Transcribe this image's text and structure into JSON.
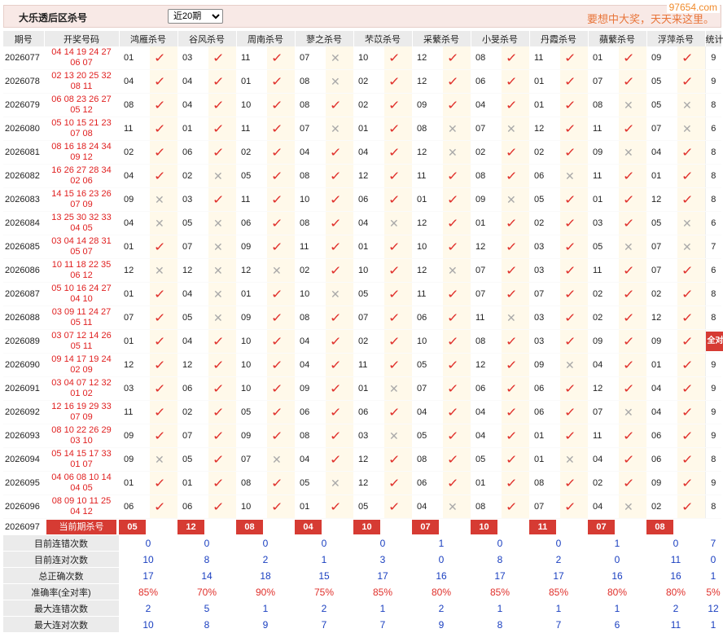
{
  "header": {
    "title": "大乐透后区杀号",
    "period_select": "近20期",
    "period_options": [
      "近20期"
    ],
    "slogan": "要想中大奖，天天来这里。",
    "watermark": "97654.com"
  },
  "columns": {
    "period": "期号",
    "winning": "开奖号码",
    "experts": [
      "鸿雁杀号",
      "谷风杀号",
      "周南杀号",
      "蓼之杀号",
      "芣苡杀号",
      "采蘩杀号",
      "小旻杀号",
      "丹霞杀号",
      "蘋蘩杀号",
      "浮萍杀号"
    ],
    "stat": "统计"
  },
  "rows": [
    {
      "period": "2026077",
      "line1": "04 14 19 24 27",
      "line2": "06 07",
      "picks": [
        [
          "01",
          1
        ],
        [
          "03",
          1
        ],
        [
          "11",
          1
        ],
        [
          "07",
          0
        ],
        [
          "10",
          1
        ],
        [
          "12",
          1
        ],
        [
          "08",
          1
        ],
        [
          "11",
          1
        ],
        [
          "01",
          1
        ],
        [
          "09",
          1
        ]
      ],
      "stat": "9"
    },
    {
      "period": "2026078",
      "line1": "02 13 20 25 32",
      "line2": "08 11",
      "picks": [
        [
          "04",
          1
        ],
        [
          "04",
          1
        ],
        [
          "01",
          1
        ],
        [
          "08",
          0
        ],
        [
          "02",
          1
        ],
        [
          "12",
          1
        ],
        [
          "06",
          1
        ],
        [
          "01",
          1
        ],
        [
          "07",
          1
        ],
        [
          "05",
          1
        ]
      ],
      "stat": "9"
    },
    {
      "period": "2026079",
      "line1": "06 08 23 26 27",
      "line2": "05 12",
      "picks": [
        [
          "08",
          1
        ],
        [
          "04",
          1
        ],
        [
          "10",
          1
        ],
        [
          "08",
          1
        ],
        [
          "02",
          1
        ],
        [
          "09",
          1
        ],
        [
          "04",
          1
        ],
        [
          "01",
          1
        ],
        [
          "08",
          0
        ],
        [
          "05",
          0
        ]
      ],
      "stat": "8"
    },
    {
      "period": "2026080",
      "line1": "05 10 15 21 23",
      "line2": "07 08",
      "picks": [
        [
          "11",
          1
        ],
        [
          "01",
          1
        ],
        [
          "11",
          1
        ],
        [
          "07",
          0
        ],
        [
          "01",
          1
        ],
        [
          "08",
          0
        ],
        [
          "07",
          0
        ],
        [
          "12",
          1
        ],
        [
          "11",
          1
        ],
        [
          "07",
          0
        ]
      ],
      "stat": "6"
    },
    {
      "period": "2026081",
      "line1": "08 16 18 24 34",
      "line2": "09 12",
      "picks": [
        [
          "02",
          1
        ],
        [
          "06",
          1
        ],
        [
          "02",
          1
        ],
        [
          "04",
          1
        ],
        [
          "04",
          1
        ],
        [
          "12",
          0
        ],
        [
          "02",
          1
        ],
        [
          "02",
          1
        ],
        [
          "09",
          0
        ],
        [
          "04",
          1
        ]
      ],
      "stat": "8"
    },
    {
      "period": "2026082",
      "line1": "16 26 27 28 34",
      "line2": "02 06",
      "picks": [
        [
          "04",
          1
        ],
        [
          "02",
          0
        ],
        [
          "05",
          1
        ],
        [
          "08",
          1
        ],
        [
          "12",
          1
        ],
        [
          "11",
          1
        ],
        [
          "08",
          1
        ],
        [
          "06",
          0
        ],
        [
          "11",
          1
        ],
        [
          "01",
          1
        ]
      ],
      "stat": "8"
    },
    {
      "period": "2026083",
      "line1": "14 15 16 23 26",
      "line2": "07 09",
      "picks": [
        [
          "09",
          0
        ],
        [
          "03",
          1
        ],
        [
          "11",
          1
        ],
        [
          "10",
          1
        ],
        [
          "06",
          1
        ],
        [
          "01",
          1
        ],
        [
          "09",
          0
        ],
        [
          "05",
          1
        ],
        [
          "01",
          1
        ],
        [
          "12",
          1
        ]
      ],
      "stat": "8"
    },
    {
      "period": "2026084",
      "line1": "13 25 30 32 33",
      "line2": "04 05",
      "picks": [
        [
          "04",
          0
        ],
        [
          "05",
          0
        ],
        [
          "06",
          1
        ],
        [
          "08",
          1
        ],
        [
          "04",
          0
        ],
        [
          "12",
          1
        ],
        [
          "01",
          1
        ],
        [
          "02",
          1
        ],
        [
          "03",
          1
        ],
        [
          "05",
          0
        ]
      ],
      "stat": "6"
    },
    {
      "period": "2026085",
      "line1": "03 04 14 28 31",
      "line2": "05 07",
      "picks": [
        [
          "01",
          1
        ],
        [
          "07",
          0
        ],
        [
          "09",
          1
        ],
        [
          "11",
          1
        ],
        [
          "01",
          1
        ],
        [
          "10",
          1
        ],
        [
          "12",
          1
        ],
        [
          "03",
          1
        ],
        [
          "05",
          0
        ],
        [
          "07",
          0
        ]
      ],
      "stat": "7"
    },
    {
      "period": "2026086",
      "line1": "10 11 18 22 35",
      "line2": "06 12",
      "picks": [
        [
          "12",
          0
        ],
        [
          "12",
          0
        ],
        [
          "12",
          0
        ],
        [
          "02",
          1
        ],
        [
          "10",
          1
        ],
        [
          "12",
          0
        ],
        [
          "07",
          1
        ],
        [
          "03",
          1
        ],
        [
          "11",
          1
        ],
        [
          "07",
          1
        ]
      ],
      "stat": "6"
    },
    {
      "period": "2026087",
      "line1": "05 10 16 24 27",
      "line2": "04 10",
      "picks": [
        [
          "01",
          1
        ],
        [
          "04",
          0
        ],
        [
          "01",
          1
        ],
        [
          "10",
          0
        ],
        [
          "05",
          1
        ],
        [
          "11",
          1
        ],
        [
          "07",
          1
        ],
        [
          "07",
          1
        ],
        [
          "02",
          1
        ],
        [
          "02",
          1
        ]
      ],
      "stat": "8"
    },
    {
      "period": "2026088",
      "line1": "03 09 11 24 27",
      "line2": "05 11",
      "picks": [
        [
          "07",
          1
        ],
        [
          "05",
          0
        ],
        [
          "09",
          1
        ],
        [
          "08",
          1
        ],
        [
          "07",
          1
        ],
        [
          "06",
          1
        ],
        [
          "11",
          0
        ],
        [
          "03",
          1
        ],
        [
          "02",
          1
        ],
        [
          "12",
          1
        ]
      ],
      "stat": "8"
    },
    {
      "period": "2026089",
      "line1": "03 07 12 14 26",
      "line2": "05 11",
      "picks": [
        [
          "01",
          1
        ],
        [
          "04",
          1
        ],
        [
          "10",
          1
        ],
        [
          "04",
          1
        ],
        [
          "02",
          1
        ],
        [
          "10",
          1
        ],
        [
          "08",
          1
        ],
        [
          "03",
          1
        ],
        [
          "09",
          1
        ],
        [
          "09",
          1
        ]
      ],
      "stat": "全对"
    },
    {
      "period": "2026090",
      "line1": "09 14 17 19 24",
      "line2": "02 09",
      "picks": [
        [
          "12",
          1
        ],
        [
          "12",
          1
        ],
        [
          "10",
          1
        ],
        [
          "04",
          1
        ],
        [
          "11",
          1
        ],
        [
          "05",
          1
        ],
        [
          "12",
          1
        ],
        [
          "09",
          0
        ],
        [
          "04",
          1
        ],
        [
          "01",
          1
        ]
      ],
      "stat": "9"
    },
    {
      "period": "2026091",
      "line1": "03 04 07 12 32",
      "line2": "01 02",
      "picks": [
        [
          "03",
          1
        ],
        [
          "06",
          1
        ],
        [
          "10",
          1
        ],
        [
          "09",
          1
        ],
        [
          "01",
          0
        ],
        [
          "07",
          1
        ],
        [
          "06",
          1
        ],
        [
          "06",
          1
        ],
        [
          "12",
          1
        ],
        [
          "04",
          1
        ]
      ],
      "stat": "9"
    },
    {
      "period": "2026092",
      "line1": "12 16 19 29 33",
      "line2": "07 09",
      "picks": [
        [
          "11",
          1
        ],
        [
          "02",
          1
        ],
        [
          "05",
          1
        ],
        [
          "06",
          1
        ],
        [
          "06",
          1
        ],
        [
          "04",
          1
        ],
        [
          "04",
          1
        ],
        [
          "06",
          1
        ],
        [
          "07",
          0
        ],
        [
          "04",
          1
        ]
      ],
      "stat": "9"
    },
    {
      "period": "2026093",
      "line1": "08 10 22 26 29",
      "line2": "03 10",
      "picks": [
        [
          "09",
          1
        ],
        [
          "07",
          1
        ],
        [
          "09",
          1
        ],
        [
          "08",
          1
        ],
        [
          "03",
          0
        ],
        [
          "05",
          1
        ],
        [
          "04",
          1
        ],
        [
          "01",
          1
        ],
        [
          "11",
          1
        ],
        [
          "06",
          1
        ]
      ],
      "stat": "9"
    },
    {
      "period": "2026094",
      "line1": "05 14 15 17 33",
      "line2": "01 07",
      "picks": [
        [
          "09",
          0
        ],
        [
          "05",
          1
        ],
        [
          "07",
          0
        ],
        [
          "04",
          1
        ],
        [
          "12",
          1
        ],
        [
          "08",
          1
        ],
        [
          "05",
          1
        ],
        [
          "01",
          0
        ],
        [
          "04",
          1
        ],
        [
          "06",
          1
        ]
      ],
      "stat": "8"
    },
    {
      "period": "2026095",
      "line1": "04 06 08 10 14",
      "line2": "04 05",
      "picks": [
        [
          "01",
          1
        ],
        [
          "01",
          1
        ],
        [
          "08",
          1
        ],
        [
          "05",
          0
        ],
        [
          "12",
          1
        ],
        [
          "06",
          1
        ],
        [
          "01",
          1
        ],
        [
          "08",
          1
        ],
        [
          "02",
          1
        ],
        [
          "09",
          1
        ]
      ],
      "stat": "9"
    },
    {
      "period": "2026096",
      "line1": "08 09 10 11 25",
      "line2": "04 12",
      "picks": [
        [
          "06",
          1
        ],
        [
          "06",
          1
        ],
        [
          "10",
          1
        ],
        [
          "01",
          1
        ],
        [
          "05",
          1
        ],
        [
          "04",
          0
        ],
        [
          "08",
          1
        ],
        [
          "07",
          1
        ],
        [
          "04",
          0
        ],
        [
          "02",
          1
        ]
      ],
      "stat": "8"
    }
  ],
  "current": {
    "period": "2026097",
    "label": "当前期杀号",
    "picks": [
      "05",
      "12",
      "08",
      "04",
      "10",
      "07",
      "10",
      "11",
      "07",
      "08"
    ]
  },
  "stats": [
    {
      "label": "目前连错次数",
      "values": [
        "0",
        "0",
        "0",
        "0",
        "0",
        "1",
        "0",
        "0",
        "1",
        "0",
        "7"
      ],
      "color": "blue"
    },
    {
      "label": "目前连对次数",
      "values": [
        "10",
        "8",
        "2",
        "1",
        "3",
        "0",
        "8",
        "2",
        "0",
        "11",
        "0"
      ],
      "color": "blue"
    },
    {
      "label": "总正确次数",
      "values": [
        "17",
        "14",
        "18",
        "15",
        "17",
        "16",
        "17",
        "17",
        "16",
        "16",
        "1"
      ],
      "color": "blue"
    },
    {
      "label": "准确率(全对率)",
      "values": [
        "85%",
        "70%",
        "90%",
        "75%",
        "85%",
        "80%",
        "85%",
        "85%",
        "80%",
        "80%",
        "5%"
      ],
      "color": "red"
    },
    {
      "label": "最大连错次数",
      "values": [
        "2",
        "5",
        "1",
        "2",
        "1",
        "2",
        "1",
        "1",
        "1",
        "2",
        "12"
      ],
      "color": "blue"
    },
    {
      "label": "最大连对次数",
      "values": [
        "10",
        "8",
        "9",
        "7",
        "7",
        "9",
        "8",
        "7",
        "6",
        "11",
        "1"
      ],
      "color": "blue"
    }
  ],
  "colors": {
    "accent": "#d63b33",
    "hit": "#e0302b",
    "miss": "#a9a9a9",
    "stat_blue": "#1a3fc0",
    "header_bg": "#ebebeb",
    "mark_bg": "#fff9ea"
  }
}
